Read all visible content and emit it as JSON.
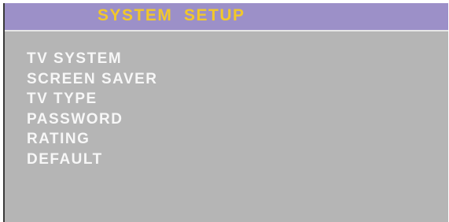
{
  "header": {
    "title": "SYSTEM  SETUP"
  },
  "menu": {
    "items": [
      {
        "label": "TV SYSTEM"
      },
      {
        "label": "SCREEN SAVER"
      },
      {
        "label": "TV TYPE"
      },
      {
        "label": "PASSWORD"
      },
      {
        "label": "RATING"
      },
      {
        "label": "DEFAULT"
      }
    ]
  },
  "colors": {
    "header_bg": "#9c90c8",
    "title_text": "#f2c82a",
    "panel_bg": "#b5b5b5",
    "menu_text": "#f7f7f7"
  }
}
